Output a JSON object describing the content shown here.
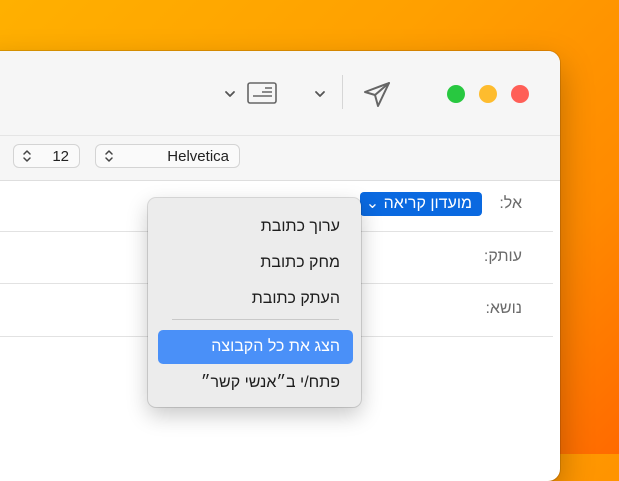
{
  "toolbar": {
    "send_icon": "paper-plane-icon",
    "header_fields_icon": "envelope-header-icon",
    "chevron_icon": "chevron-down-icon"
  },
  "format_bar": {
    "font_size": "12",
    "font_family": "Helvetica",
    "stepper_icon": "stepper-up-down-icon"
  },
  "fields": {
    "to_label": "אל:",
    "cc_label": "עותק:",
    "subject_label": "נושא:",
    "to_token": "מועדון קריאה ⌄"
  },
  "context_menu": {
    "items": [
      {
        "label": "ערוך כתובת",
        "highlighted": false
      },
      {
        "label": "מחק כתובת",
        "highlighted": false
      },
      {
        "label": "העתק כתובת",
        "highlighted": false
      },
      {
        "label": "הצג את כל הקבוצה",
        "highlighted": true
      },
      {
        "label": "פתח/י ב״אנשי קשר״",
        "highlighted": false
      }
    ]
  },
  "colors": {
    "accent_blue": "#0a69e0",
    "menu_highlight": "#4a90f8",
    "close": "#ff5f57",
    "minimize": "#febc2e",
    "zoom": "#28c840"
  }
}
